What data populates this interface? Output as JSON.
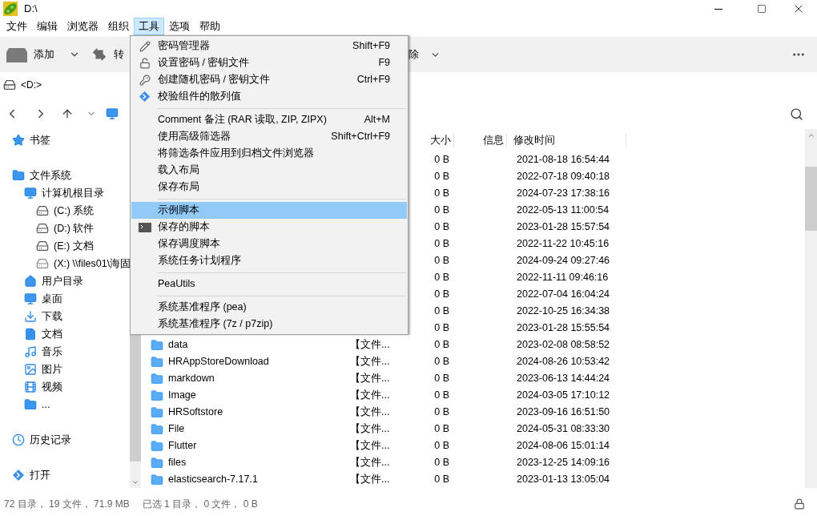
{
  "window": {
    "title": "D:\\"
  },
  "menubar": [
    {
      "label": "文件",
      "selected": false
    },
    {
      "label": "编辑",
      "selected": false
    },
    {
      "label": "浏览器",
      "selected": false
    },
    {
      "label": "组织",
      "selected": false
    },
    {
      "label": "工具",
      "selected": true
    },
    {
      "label": "选项",
      "selected": false
    },
    {
      "label": "帮助",
      "selected": false
    }
  ],
  "toolbar": {
    "add": "添加",
    "convert": "转",
    "delete": "除"
  },
  "address": "<D:>",
  "sidebar": {
    "items": [
      {
        "label": "书签",
        "kind": "bookmark"
      },
      {
        "label": "文件系统",
        "kind": "folder",
        "children": [
          {
            "label": "计算机根目录",
            "kind": "computer",
            "children": [
              {
                "label": "(C:) 系统",
                "kind": "drive"
              },
              {
                "label": "(D:) 软件",
                "kind": "drive"
              },
              {
                "label": "(E:) 文档",
                "kind": "drive"
              },
              {
                "label": "(X:) \\\\files01\\海固",
                "kind": "netdrive"
              }
            ]
          },
          {
            "label": "用户目录",
            "kind": "home"
          },
          {
            "label": "桌面",
            "kind": "desktop"
          },
          {
            "label": "下载",
            "kind": "download"
          },
          {
            "label": "文档",
            "kind": "document"
          },
          {
            "label": "音乐",
            "kind": "music"
          },
          {
            "label": "图片",
            "kind": "picture"
          },
          {
            "label": "视频",
            "kind": "video"
          },
          {
            "label": "...",
            "kind": "folder"
          }
        ]
      },
      {
        "label": "历史记录",
        "kind": "history"
      },
      {
        "label": "打开",
        "kind": "open"
      }
    ]
  },
  "table": {
    "columns": [
      "大小",
      "信息",
      "修改时间"
    ],
    "rows": [
      {
        "size": "0 B",
        "modified": "2021-08-18 16:54:44"
      },
      {
        "size": "0 B",
        "modified": "2022-07-18 09:40:18"
      },
      {
        "size": "0 B",
        "modified": "2024-07-23 17:38:16"
      },
      {
        "size": "0 B",
        "modified": "2022-05-13 11:00:54"
      },
      {
        "size": "0 B",
        "modified": "2023-01-28 15:57:54"
      },
      {
        "size": "0 B",
        "modified": "2022-11-22 10:45:16"
      },
      {
        "size": "0 B",
        "modified": "2024-09-24 09:27:46"
      },
      {
        "size": "0 B",
        "modified": "2022-11-11 09:46:16"
      },
      {
        "size": "0 B",
        "modified": "2022-07-04 16:04:24"
      },
      {
        "size": "0 B",
        "modified": "2022-10-25 16:34:38"
      },
      {
        "size": "0 B",
        "modified": "2023-01-28 15:55:54"
      },
      {
        "name": "data",
        "type": "【文件...",
        "size": "0 B",
        "modified": "2023-02-08 08:58:52"
      },
      {
        "name": "HRAppStoreDownload",
        "type": "【文件...",
        "size": "0 B",
        "modified": "2024-08-26 10:53:42"
      },
      {
        "name": "markdown",
        "type": "【文件...",
        "size": "0 B",
        "modified": "2023-06-13 14:44:24"
      },
      {
        "name": "Image",
        "type": "【文件...",
        "size": "0 B",
        "modified": "2024-03-05 17:10:12"
      },
      {
        "name": "HRSoftstore",
        "type": "【文件...",
        "size": "0 B",
        "modified": "2023-09-16 16:51:50"
      },
      {
        "name": "File",
        "type": "【文件...",
        "size": "0 B",
        "modified": "2024-05-31 08:33:30"
      },
      {
        "name": "Flutter",
        "type": "【文件...",
        "size": "0 B",
        "modified": "2024-08-06 15:01:14"
      },
      {
        "name": "files",
        "type": "【文件...",
        "size": "0 B",
        "modified": "2023-12-25 14:09:16"
      },
      {
        "name": "elasticsearch-7.17.1",
        "type": "【文件...",
        "size": "0 B",
        "modified": "2023-01-13 13:05:04"
      }
    ]
  },
  "menu": {
    "items": [
      {
        "kind": "item",
        "label": "密码管理器",
        "shortcut": "Shift+F9",
        "selected": false
      },
      {
        "kind": "item",
        "label": "设置密码 / 密钥文件",
        "shortcut": "F9",
        "selected": false
      },
      {
        "kind": "item",
        "label": "创建随机密码 / 密钥文件",
        "shortcut": "Ctrl+F9",
        "selected": false
      },
      {
        "kind": "item",
        "label": "校验组件的散列值",
        "selected": false
      },
      {
        "kind": "separator"
      },
      {
        "kind": "item",
        "label": "Comment 备注 (RAR 读取, ZIP, ZIPX)",
        "shortcut": "Alt+M",
        "selected": false
      },
      {
        "kind": "item",
        "label": "使用高级筛选器",
        "shortcut": "Shift+Ctrl+F9",
        "selected": false
      },
      {
        "kind": "item",
        "label": "将筛选条件应用到归档文件浏览器",
        "selected": false
      },
      {
        "kind": "item",
        "label": "载入布局",
        "selected": false
      },
      {
        "kind": "item",
        "label": "保存布局",
        "selected": false
      },
      {
        "kind": "separator"
      },
      {
        "kind": "item",
        "label": "示例脚本",
        "selected": true
      },
      {
        "kind": "item",
        "label": "保存的脚本",
        "selected": false
      },
      {
        "kind": "item",
        "label": "保存调度脚本",
        "selected": false
      },
      {
        "kind": "item",
        "label": "系统任务计划程序",
        "selected": false
      },
      {
        "kind": "separator"
      },
      {
        "kind": "item",
        "label": "PeaUtils",
        "selected": false
      },
      {
        "kind": "separator"
      },
      {
        "kind": "item",
        "label": "系统基准程序 (pea)",
        "selected": false
      },
      {
        "kind": "item",
        "label": "系统基准程序 (7z / p7zip)",
        "selected": false
      }
    ]
  },
  "status_bar": {
    "totals": "72 目录， 19 文件， 71.9 MB",
    "selection": "已选 1 目录， 0 文件， 0 B"
  }
}
